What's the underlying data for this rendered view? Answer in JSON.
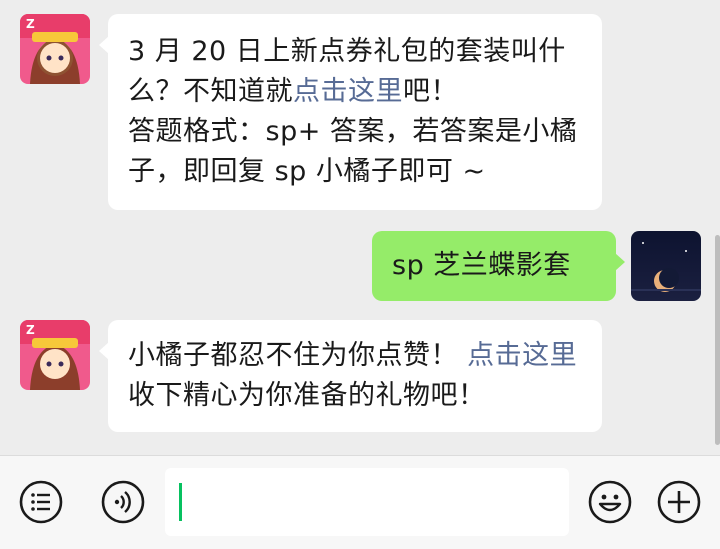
{
  "messages": [
    {
      "side": "in",
      "avatar_icon": "game-avatar-icon",
      "lines": [
        {
          "text": "3 月 20 日上新点券礼包的套装叫什"
        },
        {
          "text": "么？不知道就",
          "link": "点击这里",
          "after": "吧！"
        },
        {
          "text": "答题格式：sp+ 答案，若答案是小橘"
        },
        {
          "text": "子，即回复 sp 小橘子即可 ~"
        }
      ]
    },
    {
      "side": "out",
      "avatar_icon": "moon-night-avatar-icon",
      "text": "sp 芝兰蝶影套装"
    },
    {
      "side": "in",
      "avatar_icon": "game-avatar-icon",
      "lines": [
        {
          "text": "小橘子都忍不住为你点赞！",
          "link": "点击这里"
        },
        {
          "text": "收下精心为你准备的礼物吧！"
        }
      ]
    }
  ],
  "bottom_bar": {
    "left_icons": [
      "menu-icon",
      "voice-icon"
    ],
    "right_icons": [
      "emoji-icon",
      "add-icon"
    ],
    "input_value": ""
  },
  "colors": {
    "incoming_bubble": "#ffffff",
    "outgoing_bubble": "#95ec69",
    "link": "#576b95",
    "background": "#ededed",
    "cursor": "#07c160"
  }
}
